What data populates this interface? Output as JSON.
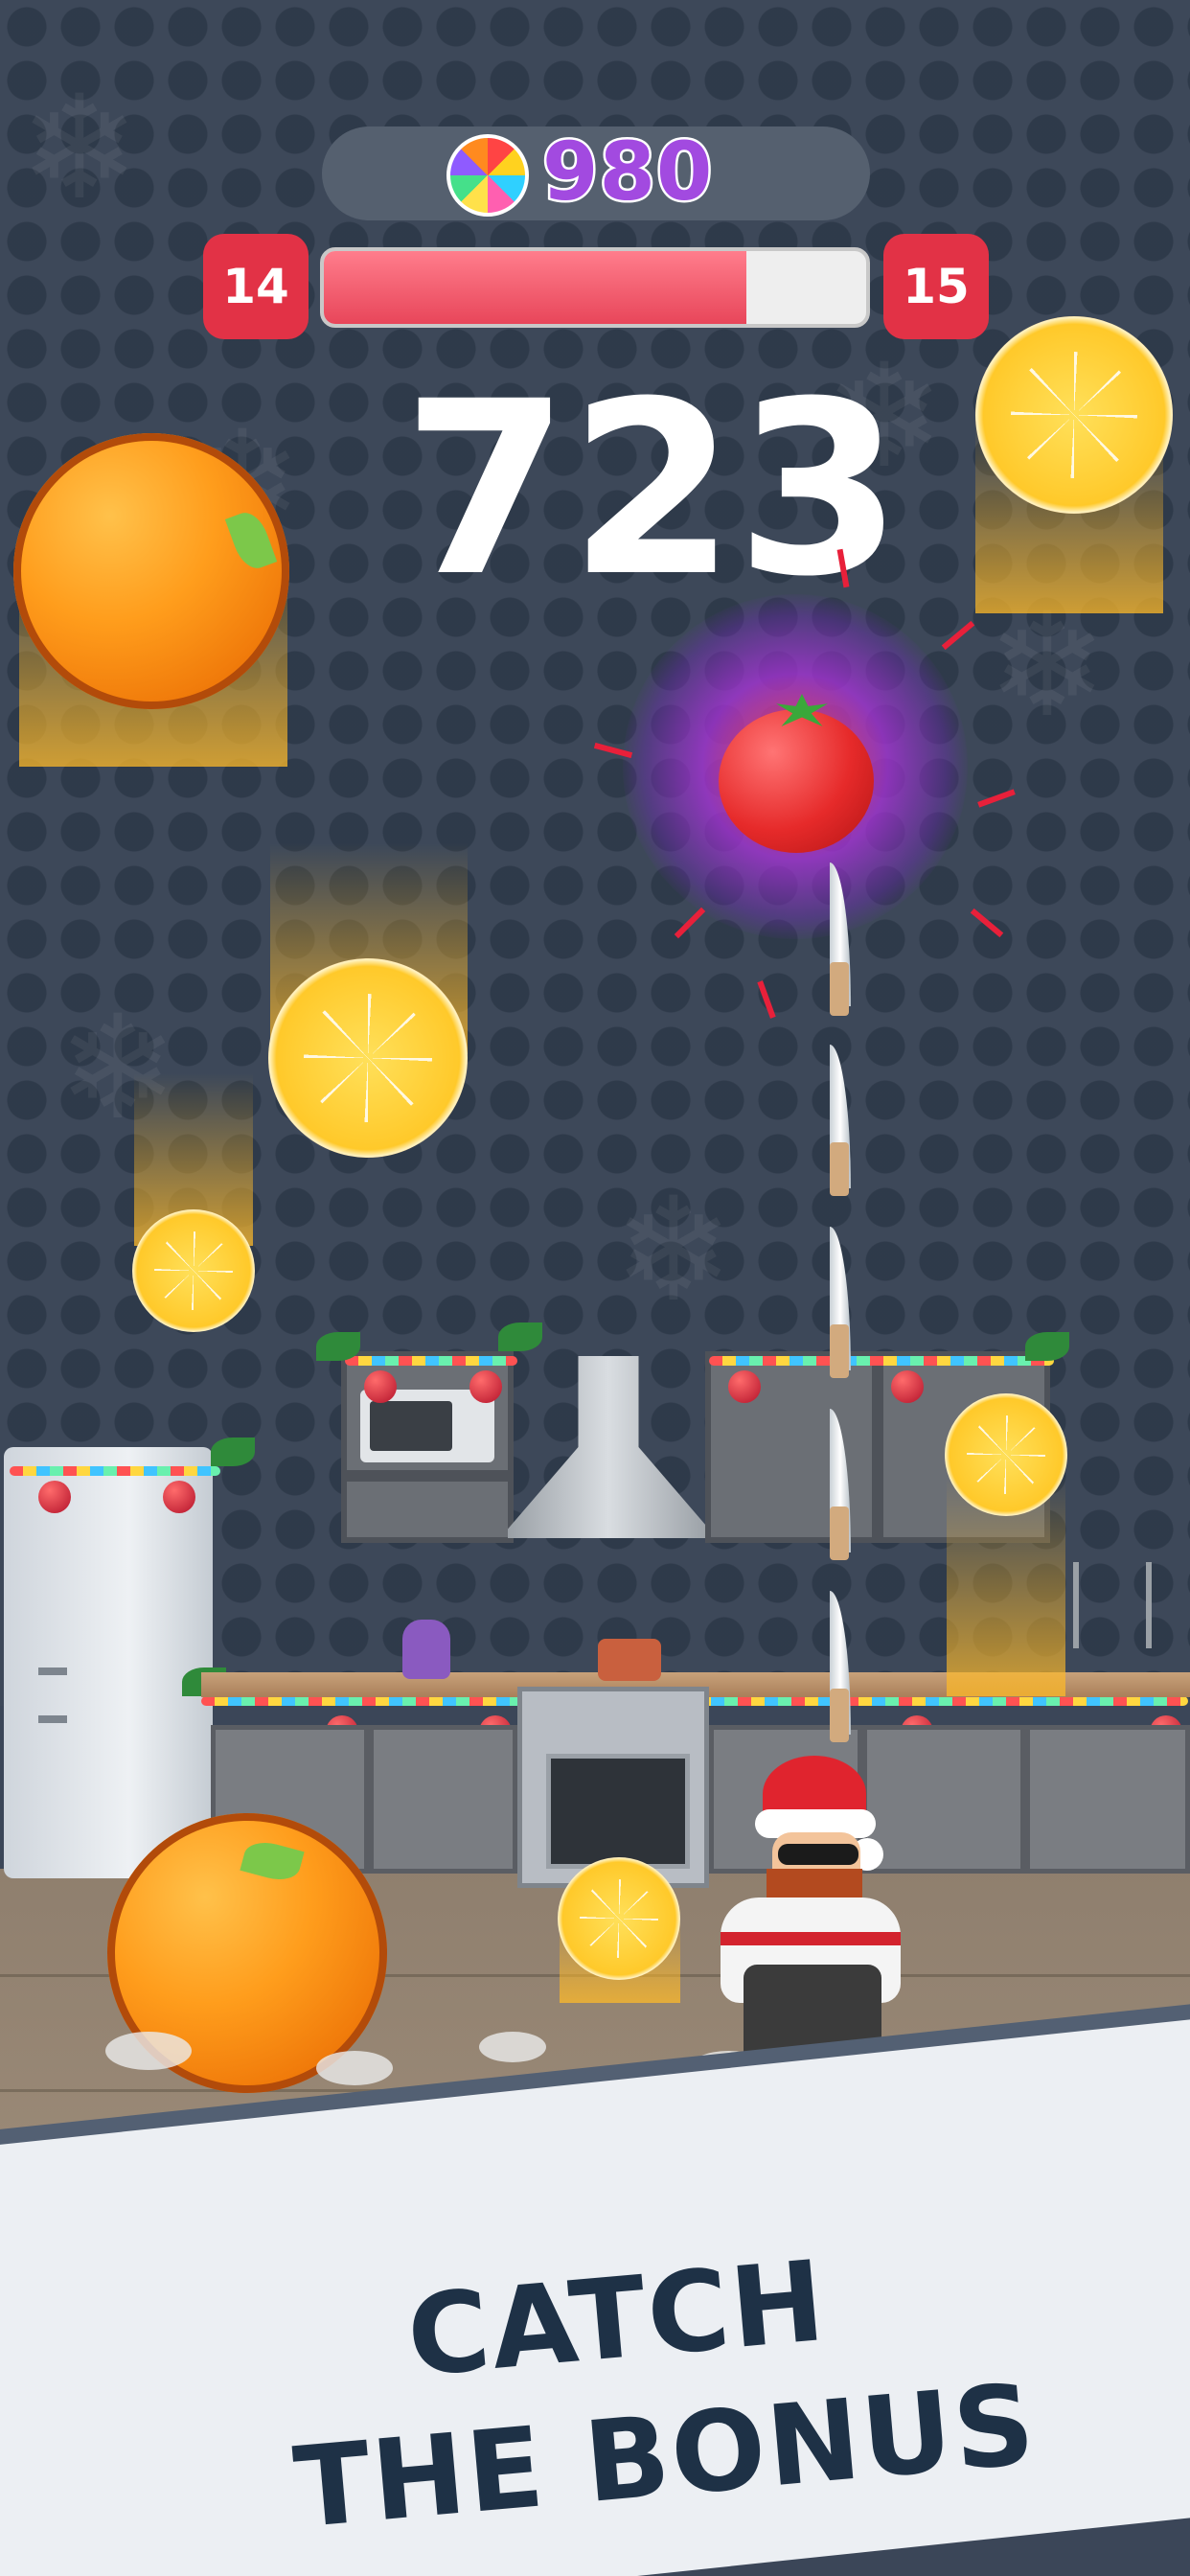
{
  "hud": {
    "coins": "980",
    "level_current": "14",
    "level_next": "15",
    "progress": 0.78,
    "score": "723"
  },
  "banner": {
    "line1": "CATCH",
    "line2": "THE BONUS"
  },
  "colors": {
    "level_badge": "#e23246",
    "progress_fill": "#e8465a",
    "coin_text": "#a24ae0",
    "banner_text": "#1e3146"
  }
}
